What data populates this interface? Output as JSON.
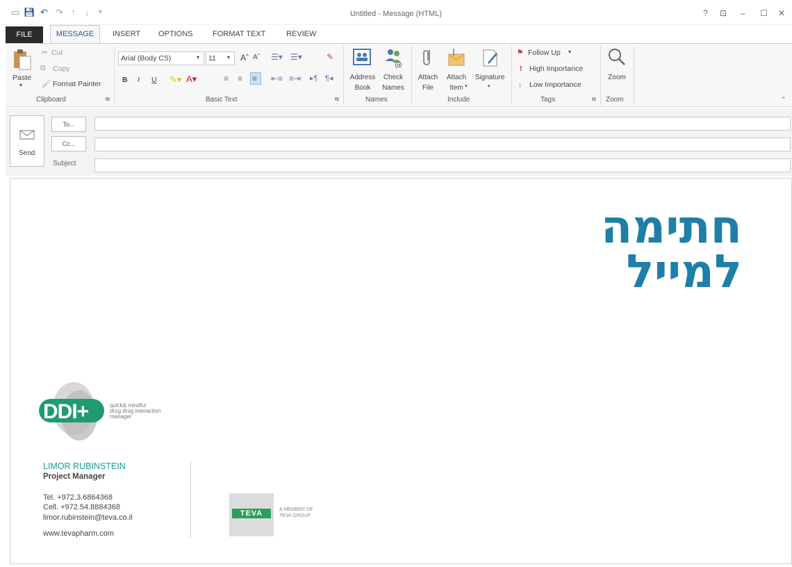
{
  "window": {
    "title": "Untitled - Message (HTML)",
    "help": "?",
    "restore_ribbon": "⊡",
    "minimize": "–",
    "maximize": "☐",
    "close": "✕"
  },
  "tabs": {
    "file": "FILE",
    "message": "MESSAGE",
    "insert": "INSERT",
    "options": "OPTIONS",
    "format_text": "FORMAT TEXT",
    "review": "REVIEW"
  },
  "ribbon": {
    "clipboard": {
      "paste": "Paste",
      "cut": "Cut",
      "copy": "Copy",
      "format_painter": "Format Painter",
      "label": "Clipboard"
    },
    "basic_text": {
      "font": "Arial (Body CS)",
      "size": "11",
      "bold": "B",
      "italic": "I",
      "underline": "U",
      "label": "Basic Text"
    },
    "names": {
      "address_book_1": "Address",
      "address_book_2": "Book",
      "check_names_1": "Check",
      "check_names_2": "Names",
      "label": "Names"
    },
    "include": {
      "attach_file_1": "Attach",
      "attach_file_2": "File",
      "attach_item_1": "Attach",
      "attach_item_2": "Item",
      "signature": "Signature",
      "label": "Include"
    },
    "tags": {
      "follow_up": "Follow Up",
      "high_importance": "High Importance",
      "low_importance": "Low Importance",
      "label": "Tags"
    },
    "zoom": {
      "zoom": "Zoom",
      "label": "Zoom"
    }
  },
  "compose": {
    "send": "Send",
    "to": "To...",
    "cc": "Cc...",
    "subject": "Subject",
    "to_value": "",
    "cc_value": "",
    "subject_value": ""
  },
  "message": {
    "hebrew_line1": "חתימה",
    "hebrew_line2": "למייל",
    "ddi_logo_text": "DDI+",
    "ddi_tagline_1": "quick& mindful",
    "ddi_tagline_2": "drug drug interaction",
    "ddi_tagline_3": "manager",
    "name": "LIMOR RUBINSTEIN",
    "role": "Project Manager",
    "tel": "Tel. +972.3.6864368",
    "cell": "Cell. +972.54.8884368",
    "email": "limor.rubinstein@teva.co.il",
    "website": "www.tevapharm.com",
    "teva_logo": "TEVA",
    "teva_member_1": "A MEMBER OF",
    "teva_member_2": "TEVA GROUP"
  },
  "colors": {
    "accent": "#2b579a",
    "hebrew": "#1f7fa8",
    "ddi_green": "#1f9b74",
    "name_teal": "#1a9d8a",
    "teva_green": "#2aa05a"
  }
}
